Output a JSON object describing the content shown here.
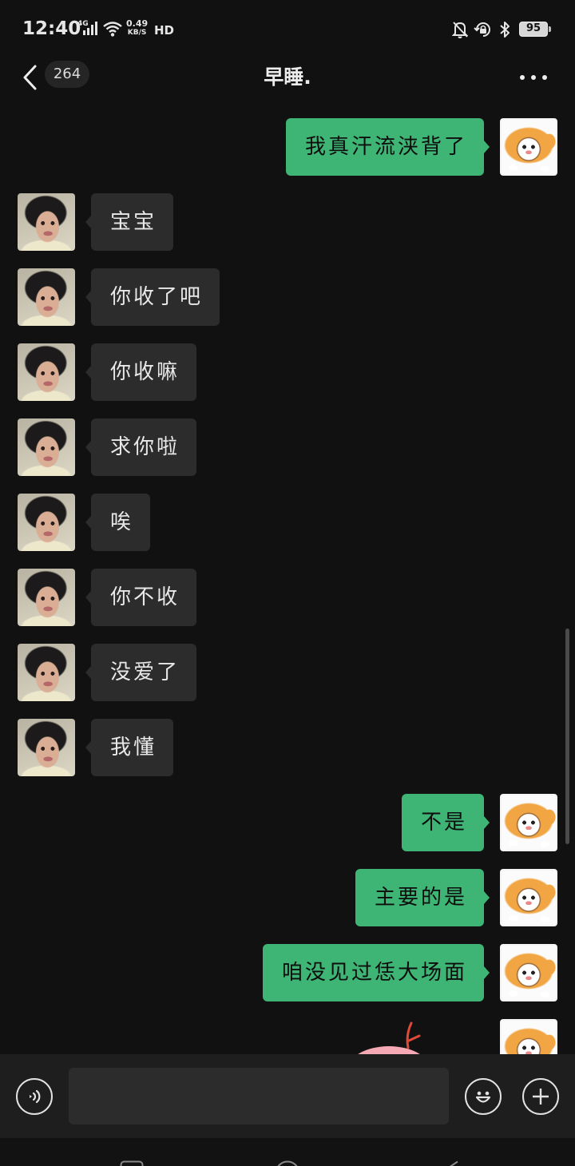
{
  "status_bar": {
    "time": "12:40",
    "network": "4G",
    "speed_value": "0.49",
    "speed_unit": "KB/S",
    "hd": "HD",
    "battery": "95",
    "icons": [
      "signal-icon",
      "wifi-icon",
      "bell-off-icon",
      "rotation-lock-icon",
      "bluetooth-icon",
      "battery-icon"
    ]
  },
  "header": {
    "unread_count": "264",
    "title": "早睡.",
    "icons": [
      "back-chevron-icon",
      "more-icon"
    ]
  },
  "messages": [
    {
      "avatar": "my-avatar",
      "text": "我真汗流浃背了"
    },
    {
      "avatar": "contact-avatar",
      "text": "宝宝"
    },
    {
      "avatar": "contact-avatar",
      "text": "你收了吧"
    },
    {
      "avatar": "contact-avatar",
      "text": "你收嘛"
    },
    {
      "avatar": "contact-avatar",
      "text": "求你啦"
    },
    {
      "avatar": "contact-avatar",
      "text": "唉"
    },
    {
      "avatar": "contact-avatar",
      "text": "你不收"
    },
    {
      "avatar": "contact-avatar",
      "text": "没爱了"
    },
    {
      "avatar": "contact-avatar",
      "text": "我懂"
    },
    {
      "avatar": "my-avatar",
      "text": "不是"
    },
    {
      "avatar": "my-avatar",
      "text": "主要的是"
    },
    {
      "avatar": "my-avatar",
      "text": "咱没见过恁大场面"
    },
    {
      "avatar": "my-avatar",
      "sticker": "pink-bird-sticker"
    }
  ],
  "input_bar": {
    "value": "",
    "icons": [
      "voice-icon",
      "emoji-icon",
      "plus-icon"
    ]
  },
  "nav_bar": {
    "icons": [
      "recent-apps-icon",
      "home-icon",
      "back-icon"
    ]
  },
  "colors": {
    "background": "#111111",
    "incoming_bubble": "#2c2c2c",
    "outgoing_bubble": "#3eb575",
    "incoming_text": "#e8e8e8",
    "outgoing_text": "#0d0d0d",
    "input_bar": "#1e1e1e"
  }
}
